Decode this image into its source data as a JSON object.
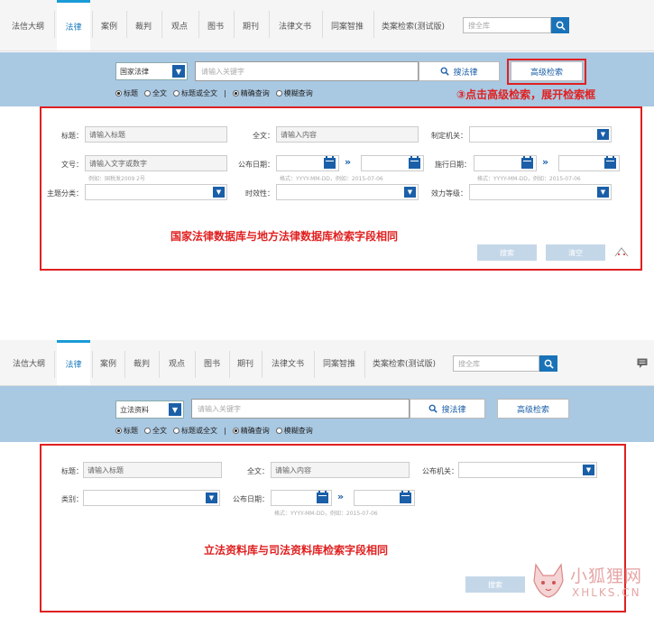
{
  "nav": {
    "items": [
      "法信大纲",
      "法律",
      "案例",
      "裁判",
      "观点",
      "图书",
      "期刊",
      "法律文书",
      "同案智推",
      "类案检索(测试版)"
    ],
    "search_placeholder": "搜全库"
  },
  "top": {
    "db_select": "国家法律",
    "keyword_placeholder": "请输入关键字",
    "search_button": "搜法律",
    "advanced_button": "高级检索",
    "radios": {
      "title": "标题",
      "fulltext": "全文",
      "title_or_full": "标题或全文",
      "sep": "|",
      "exact": "精确查询",
      "fuzzy": "模糊查询"
    },
    "annotation": "③点击高级检索，展开检索框",
    "form": {
      "title_label": "标题：",
      "title_placeholder": "请输入标题",
      "full_label": "全文：",
      "full_placeholder": "请输入内容",
      "org_label": "制定机关：",
      "docno_label": "文号：",
      "docno_placeholder": "请输入文字或数字",
      "docno_hint": "例如：国税发2009 2号",
      "pub_label": "公布日期：",
      "pub_hint": "格式：YYYY-MM-DD，例如：2015-07-06",
      "eff_label": "施行日期：",
      "eff_hint": "格式：YYYY-MM-DD，例如：2015-07-06",
      "topic_label": "主题分类：",
      "validity_label": "时效性：",
      "level_label": "效力等级：",
      "search": "搜索",
      "clear": "清空"
    },
    "caption": "国家法律数据库与地方法律数据库检索字段相同"
  },
  "bottom": {
    "db_select": "立法资料",
    "keyword_placeholder": "请输入关键字",
    "search_button": "搜法律",
    "advanced_button": "高级检索",
    "radios": {
      "title": "标题",
      "fulltext": "全文",
      "title_or_full": "标题或全文",
      "sep": "|",
      "exact": "精确查询",
      "fuzzy": "模糊查询"
    },
    "form": {
      "title_label": "标题：",
      "title_placeholder": "请输入标题",
      "full_label": "全文：",
      "full_placeholder": "请输入内容",
      "org_label": "公布机关：",
      "type_label": "类别：",
      "pub_label": "公布日期：",
      "pub_hint": "格式：YYYY-MM-DD，例如：2015-07-06",
      "search": "搜索"
    },
    "caption": "立法资料库与司法资料库检索字段相同"
  },
  "watermark": {
    "text": "小狐狸网",
    "sub": "XHLKS.CN"
  }
}
